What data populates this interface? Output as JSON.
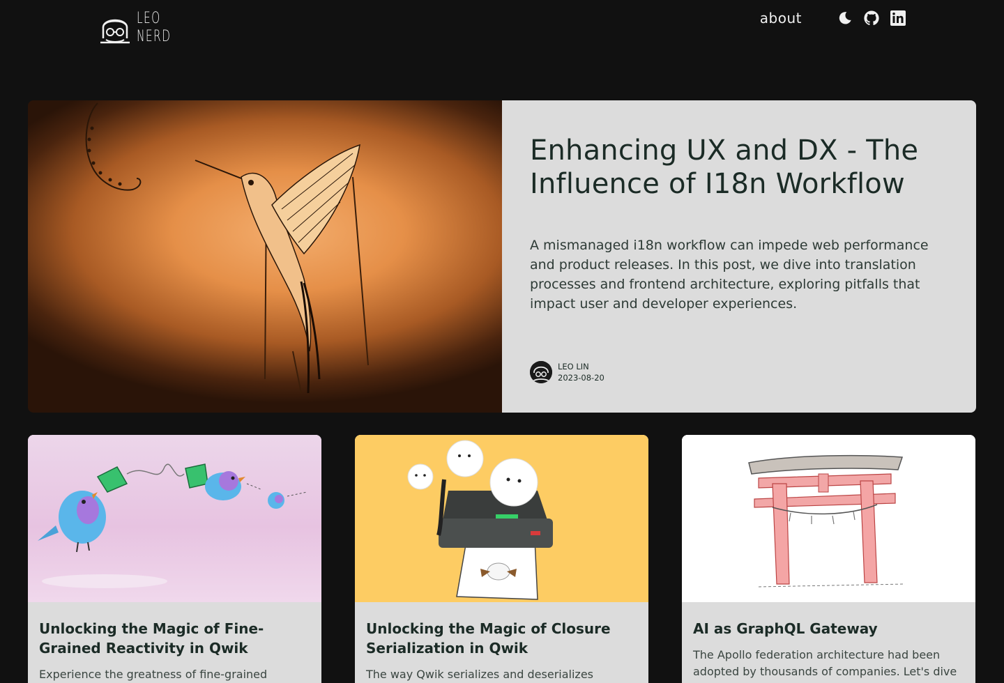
{
  "header": {
    "logo_line1": "LEO",
    "logo_line2": "NERD",
    "nav_about": "about",
    "icons": [
      "moon-icon",
      "github-icon",
      "linkedin-icon"
    ]
  },
  "hero": {
    "title": "Enhancing UX and DX - The Influence of I18n Workflow",
    "description": "A mismanaged i18n workflow can impede web performance and product releases. In this post, we dive into translation processes and frontend architecture, exploring pitfalls that impact user and developer experiences.",
    "author": "LEO LIN",
    "date": "2023-08-20"
  },
  "cards": [
    {
      "title": "Unlocking the Magic of Fine-Grained Reactivity in Qwik",
      "description": "Experience the greatness of fine-grained"
    },
    {
      "title": "Unlocking the Magic of Closure Serialization in Qwik",
      "description": "The way Qwik serializes and deserializes"
    },
    {
      "title": "AI as GraphQL Gateway",
      "description": "The Apollo federation architecture had been adopted by thousands of companies. Let's dive"
    }
  ],
  "colors": {
    "page_bg": "#111111",
    "card_bg": "#dcdcdc",
    "text_dark": "#1b2b26"
  }
}
